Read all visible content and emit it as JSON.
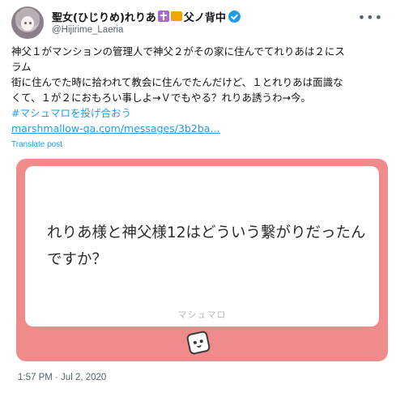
{
  "author": {
    "display_name": "聖女(ひじりめ)れりあ",
    "name_suffix": "父ノ背中",
    "handle": "@Hijirime_Laeria"
  },
  "tweet": {
    "lines": [
      "神父１がマンションの管理人で神父２がその家に住んでてれりあは２にス",
      "ラム",
      "街に住んでた時に拾われて教会に住んでたんだけど、１とれりあは面識な",
      "くて、１が２におもろい事しよ→Ｖでもやる？れりあ誘うわ→今。"
    ],
    "hashtag": "#マシュマロを投げ合おう",
    "link": "marshmallow-qa.com/messages/3b2ba…",
    "translate_label": "Translate post",
    "timestamp": "1:57 PM · Jul 2, 2020"
  },
  "card": {
    "question": "れりあ様と神父様12はどういう繋がりだったんですか？",
    "brand": "マシュマロ",
    "colors": {
      "background": "#ef8b8b",
      "panel": "#ffffff"
    }
  },
  "icons": [
    "more-icon",
    "verified-badge-icon",
    "cross-emoji-icon",
    "book-emoji-icon",
    "marshmallow-mascot-icon"
  ]
}
